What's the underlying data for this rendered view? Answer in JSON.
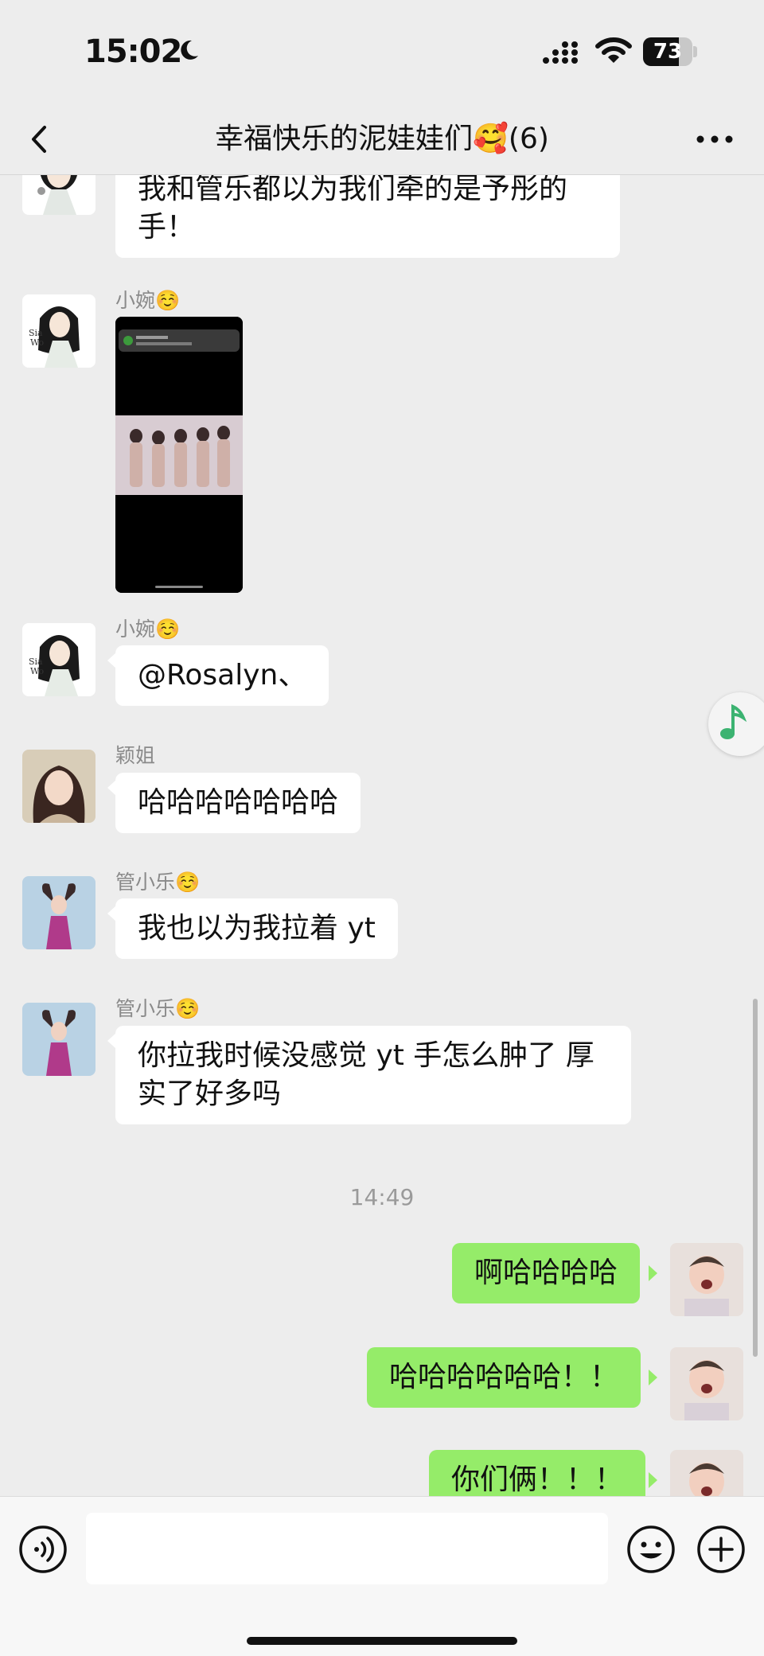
{
  "status_bar": {
    "time": "15:02",
    "battery": "73",
    "battery_level": 0.73
  },
  "header": {
    "title": "幸福快乐的泥娃娃们🥰(6)",
    "back_icon": "chevron-left-icon",
    "more_icon": "more-dots-icon"
  },
  "messages": [
    {
      "type": "text",
      "direction": "in",
      "sender": "",
      "text": "我和管乐都以为我们牵的是予彤的手！"
    },
    {
      "type": "image",
      "direction": "in",
      "sender": "小婉☺️"
    },
    {
      "type": "text",
      "direction": "in",
      "sender": "小婉☺️",
      "text": "@Rosalyn、"
    },
    {
      "type": "text",
      "direction": "in",
      "sender": "颖姐",
      "text": "哈哈哈哈哈哈哈"
    },
    {
      "type": "text",
      "direction": "in",
      "sender": "管小乐☺️",
      "text": "我也以为我拉着 yt"
    },
    {
      "type": "text",
      "direction": "in",
      "sender": "管小乐☺️",
      "text": "你拉我时候没感觉 yt 手怎么肿了 厚实了好多吗"
    },
    {
      "type": "timestamp",
      "text": "14:49"
    },
    {
      "type": "text",
      "direction": "out",
      "text": "啊哈哈哈哈"
    },
    {
      "type": "text",
      "direction": "out",
      "text": "哈哈哈哈哈哈！！"
    },
    {
      "type": "text",
      "direction": "out",
      "text": "你们俩！！！"
    }
  ],
  "floating": {
    "icon": "music-note-icon"
  },
  "input_bar": {
    "voice_icon": "voice-icon",
    "placeholder": "",
    "emoji_icon": "emoji-icon",
    "plus_icon": "plus-icon"
  },
  "colors": {
    "background": "#ededed",
    "bubble_in": "#ffffff",
    "bubble_out": "#95ec69",
    "music_accent": "#3cb371"
  }
}
